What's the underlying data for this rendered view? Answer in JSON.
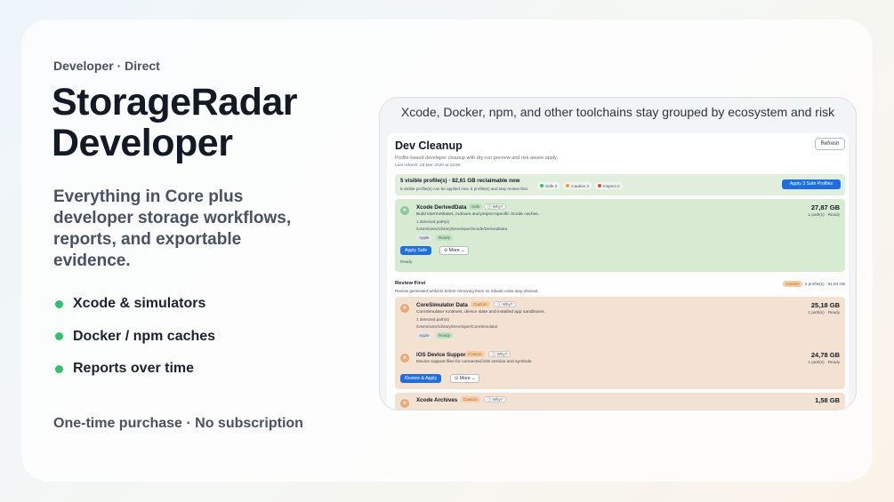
{
  "hero": {
    "eyebrow": "Developer · Direct",
    "title_line1": "StorageRadar",
    "title_line2": "Developer",
    "subtitle": "Everything in Core plus developer storage workflows, reports, and exportable evidence.",
    "bullets": [
      "Xcode & simulators",
      "Docker / npm caches",
      "Reports over time"
    ],
    "footer": "One-time purchase · No subscription",
    "accent_color": "#34c068"
  },
  "screenshot": {
    "caption": "Xcode, Docker, npm, and other toolchains stay grouped by ecosystem and risk",
    "app": {
      "title": "Dev Cleanup",
      "subtitle": "Profile-based developer cleanup with dry-run preview and risk-aware apply.",
      "last_refresh": "Last refresh: 29 Mar 2026 at 16:59",
      "refresh_button": "Refresh",
      "summary": {
        "main": "5 visible profile(s) · 82,61 GB reclaimable now",
        "sub": "5 visible profile(s) can be applied now. 5 profile(s) and stay review-first.",
        "chip_safe": "Safe 2",
        "chip_caution": "Caution 3",
        "chip_inspect": "Inspect 0",
        "apply_button": "Apply 3 Safe Profiles"
      },
      "safe_item": {
        "name": "Xcode DerivedData",
        "risk": "Safe",
        "why": "ⓘ Why?",
        "desc": "Build intermediates, indexes and project-specific Xcode caches.",
        "detected": "1 detected path(s)",
        "path": "/Users/user/Library/Developer/Xcode/DerivedData",
        "tag_vendor": "Apple",
        "tag_status": "Ready",
        "size": "27,87 GB",
        "meta": "1 path(s) · Ready",
        "apply_button": "Apply Safe",
        "more_button": "⊙ More",
        "status": "Ready"
      },
      "review_section": {
        "title": "Review First",
        "sub": "Review generated artifacts before removing them so rebuild costs stay obvious.",
        "badge": "Caution",
        "summary": "2 profile(s) · 51,84 GB"
      },
      "caution_items": [
        {
          "name": "CoreSimulator Data",
          "risk": "Caution",
          "why": "ⓘ Why?",
          "desc": "CoreSimulator runtimes, device state and installed app sandboxes.",
          "detected": "1 detected path(s)",
          "path": "/Users/user/Library/Developer/CoreSimulator",
          "tag_vendor": "Apple",
          "tag_status": "Ready",
          "size": "25,18 GB",
          "meta": "1 path(s) · Ready"
        },
        {
          "name": "iOS Device Support",
          "risk": "Caution",
          "why": "ⓘ Why?",
          "desc": "Device support files for connected iOS version and symbols.",
          "size": "24,78 GB",
          "meta": "1 path(s) · Ready",
          "review_button": "Review & Apply",
          "more_button": "⊙ More"
        },
        {
          "name": "Xcode Archives",
          "risk": "Caution",
          "why": "ⓘ Why?",
          "size": "1,58 GB"
        }
      ]
    }
  }
}
